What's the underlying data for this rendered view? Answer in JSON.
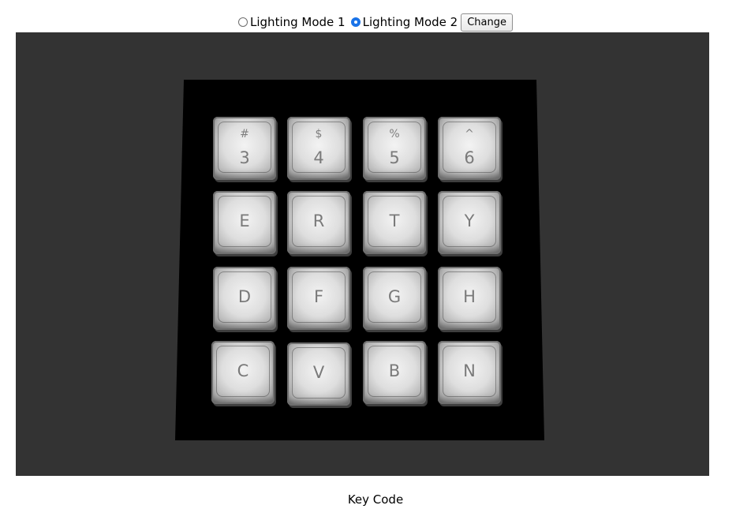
{
  "controls": {
    "mode1_label": "Lighting Mode 1",
    "mode2_label": "Lighting Mode 2",
    "selected_mode": 2,
    "change_label": "Change"
  },
  "keyboard": {
    "rows": [
      [
        {
          "top": "#",
          "main": "3"
        },
        {
          "top": "$",
          "main": "4"
        },
        {
          "top": "%",
          "main": "5"
        },
        {
          "top": "^",
          "main": "6"
        }
      ],
      [
        {
          "main": "E"
        },
        {
          "main": "R"
        },
        {
          "main": "T"
        },
        {
          "main": "Y"
        }
      ],
      [
        {
          "main": "D"
        },
        {
          "main": "F"
        },
        {
          "main": "G"
        },
        {
          "main": "H"
        }
      ],
      [
        {
          "main": "C"
        },
        {
          "main": "V"
        },
        {
          "main": "B"
        },
        {
          "main": "N"
        }
      ]
    ]
  },
  "footer": {
    "label": "Key Code"
  }
}
